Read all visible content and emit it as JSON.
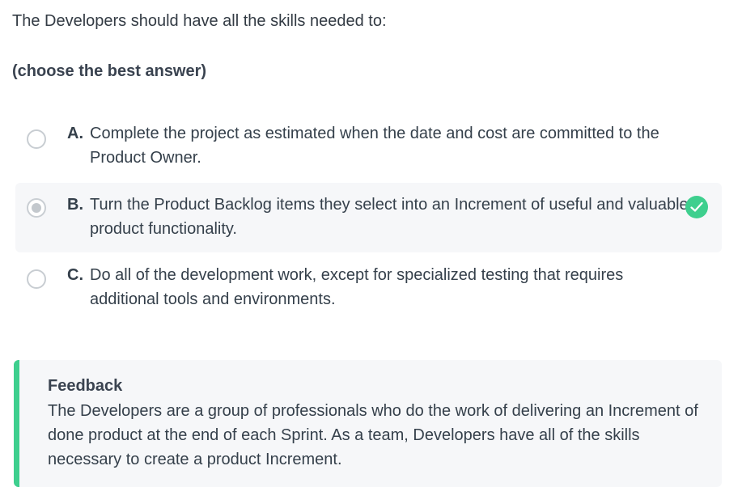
{
  "question": {
    "text": "The Developers should have all the skills needed to:",
    "instruction": "(choose the best answer)"
  },
  "options": [
    {
      "letter": "A.",
      "text": "Complete the project as estimated when the date and cost are committed to the Product Owner.",
      "selected": false,
      "correct": false
    },
    {
      "letter": "B.",
      "text": "Turn the Product Backlog items they select into an Increment of useful and valuable product functionality.",
      "selected": true,
      "correct": true
    },
    {
      "letter": "C.",
      "text": "Do all of the development work, except for specialized testing that requires additional tools and environments.",
      "selected": false,
      "correct": false
    }
  ],
  "feedback": {
    "title": "Feedback",
    "body": "The Developers are a group of professionals who do the work of delivering an Increment of done product at the end of each Sprint. As a team, Developers have all of the skills necessary to create a product Increment."
  },
  "icons": {
    "correct": "check-circle-icon"
  },
  "colors": {
    "accent_green": "#3ecf8e",
    "selected_bg": "#f6f7f9",
    "feedback_bg": "#f6f7f9",
    "text": "#35404b"
  }
}
